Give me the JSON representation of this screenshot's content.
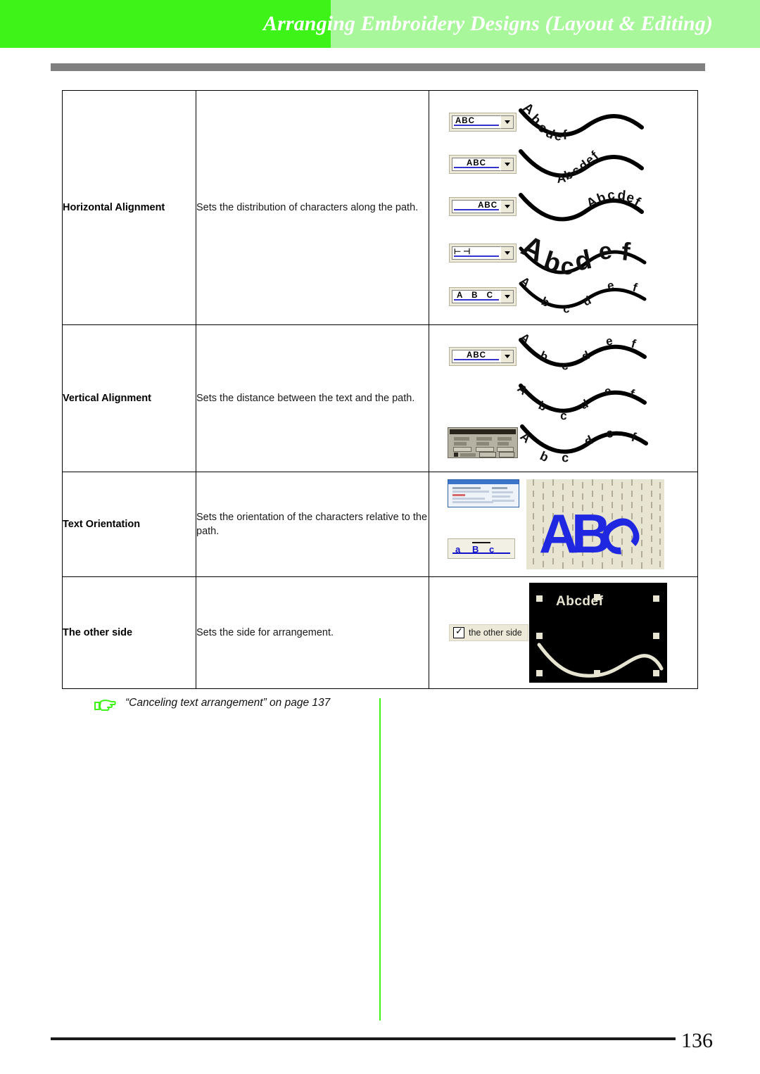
{
  "header": {
    "title": "Arranging Embroidery Designs (Layout & Editing)",
    "band_dark_color": "#3df318",
    "band_light_color": "#a8f79a",
    "rule_color": "#808080"
  },
  "table": {
    "rows": [
      {
        "term": "Horizontal Alignment",
        "description": "Sets the distribution of characters along the path.",
        "figures": [
          {
            "widget": "combo",
            "value": "ABC",
            "align": "left",
            "sample_text": "Abcdef"
          },
          {
            "widget": "combo",
            "value": "ABC",
            "align": "center",
            "sample_text": "Abcdef"
          },
          {
            "widget": "combo",
            "value": "ABC",
            "align": "right",
            "sample_text": "Abcdef"
          },
          {
            "widget": "combo",
            "value": "ABC",
            "align": "justify",
            "marks": "⊢ ⊣",
            "sample_text": "Abcdef"
          },
          {
            "widget": "combo",
            "value": "A B C",
            "align": "spread",
            "sample_text": "Abcdef"
          }
        ]
      },
      {
        "term": "Vertical Alignment",
        "description": "Sets the distance between the text and the path.",
        "figures": [
          {
            "widget": "combo",
            "value": "ABC",
            "align": "center",
            "sample_text": "Abcdef"
          },
          {
            "widget": "none",
            "sample_text": "Abcdef"
          },
          {
            "widget": "dialog-grey",
            "sample_text": "Abcdef"
          }
        ]
      },
      {
        "term": "Text Orientation",
        "description": "Sets the orientation of the characters relative to the path.",
        "figures": [
          {
            "widget": "dialog-blue"
          },
          {
            "widget": "abc-orientation",
            "value": "ABC"
          },
          {
            "widget": "stitch-canvas",
            "sample_text": "ABC"
          }
        ]
      },
      {
        "term": "The other side",
        "description": "Sets the side for arrangement.",
        "figures": [
          {
            "widget": "checkbox",
            "label": "the other side",
            "checked": true
          },
          {
            "widget": "black-canvas",
            "sample_text": "Abcdef"
          }
        ]
      }
    ]
  },
  "note": {
    "icon": "pointing-hand-icon",
    "icon_color": "#3df318",
    "text": "“Canceling text arrangement” on page 137"
  },
  "footer": {
    "page_number": "136"
  }
}
